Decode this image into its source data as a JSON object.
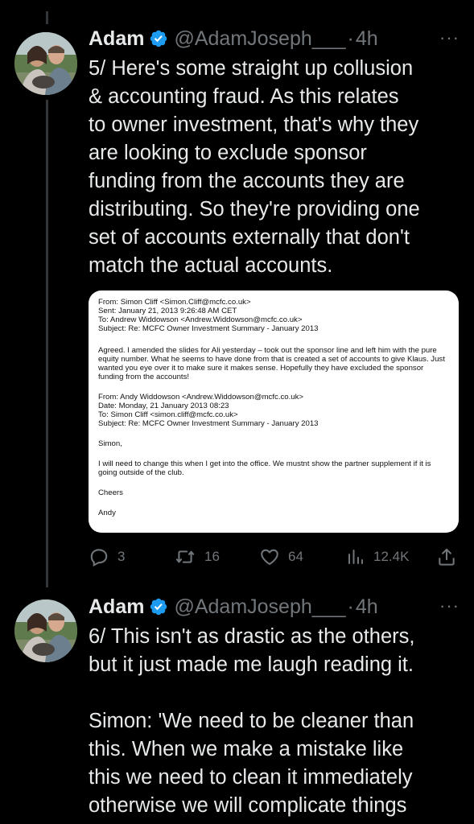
{
  "tweets": [
    {
      "name": "Adam",
      "handle": "@AdamJoseph___",
      "time": "4h",
      "text": [
        "5/ Here's some straight up collusion",
        "& accounting fraud. As this relates",
        "to owner investment, that's why they",
        "are looking to exclude sponsor",
        "funding from the accounts they are",
        "distributing. So they're providing one",
        "set of accounts externally that don't",
        "match the actual accounts."
      ],
      "email": {
        "header1": [
          "From: Simon Cliff <Simon.Cliff@mcfc.co.uk>",
          "Sent: January 21, 2013 9:26:48 AM CET",
          "To: Andrew Widdowson <Andrew.Widdowson@mcfc.co.uk>",
          "Subject: Re: MCFC Owner Investment Summary - January 2013"
        ],
        "body1": [
          "Agreed. I amended the slides for Ali yesterday – took out the sponsor line and left him with the pure",
          "equity number. What he seems to have done from that is created a set of accounts to give Klaus. Just",
          "wanted you eye over it to make sure it makes sense. Hopefully they have excluded the sponsor",
          "funding from the accounts!"
        ],
        "header2": [
          "From: Andy Widdowson <Andrew.Widdowson@mcfc.co.uk>",
          "Date: Monday, 21 January 2013 08:23",
          "To: Simon Cliff <simon.cliff@mcfc.co.uk>",
          "Subject: Re: MCFC Owner Investment Summary - January 2013"
        ],
        "greeting": "Simon,",
        "body2": [
          "I will need to change this when I get into the office. We mustnt show the partner supplement if it is",
          "going outside of the club."
        ],
        "signoff": "Cheers",
        "signature": "Andy"
      },
      "actions": {
        "replies": "3",
        "retweets": "16",
        "likes": "64",
        "views": "12.4K"
      }
    },
    {
      "name": "Adam",
      "handle": "@AdamJoseph___",
      "time": "4h",
      "text": [
        "6/ This isn't as drastic as the others,",
        "but it just made me laugh reading it.",
        "",
        "Simon: 'We need to be cleaner than",
        "this. When we make a mistake like",
        "this we need to clean it immediately",
        "otherwise we will complicate things"
      ]
    }
  ],
  "icons": {
    "verified_badge": "verified-badge-icon",
    "reply": "reply-icon",
    "retweet": "retweet-icon",
    "like": "heart-icon",
    "views": "analytics-icon",
    "share": "share-icon",
    "more": "more-options-icon"
  },
  "colors": {
    "background": "#000000",
    "text": "#e7e9ea",
    "secondary": "#71767b",
    "verified": "#1d9bf0",
    "thread_line": "#333639"
  }
}
